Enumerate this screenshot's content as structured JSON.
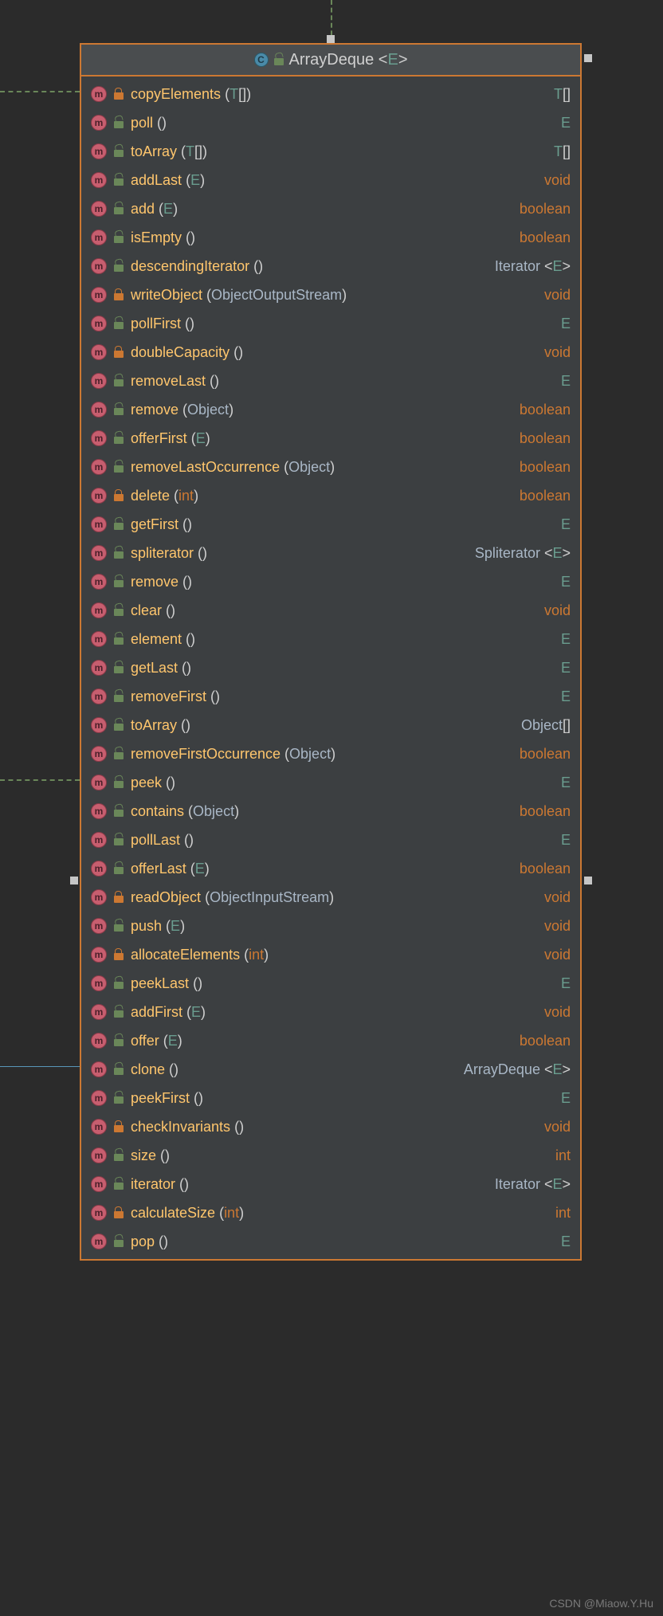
{
  "title": {
    "name": "ArrayDeque",
    "generic": "E"
  },
  "watermark": "CSDN @Miaow.Y.Hu",
  "methods": [
    {
      "name": "copyElements",
      "params": [
        {
          "t": "T",
          "sfx": "[]",
          "cls": "gen"
        }
      ],
      "ret": {
        "t": "T",
        "sfx": "[]",
        "cls": "gen"
      },
      "access": "private"
    },
    {
      "name": "poll",
      "params": [],
      "ret": {
        "t": "E",
        "cls": "gen"
      },
      "access": "public"
    },
    {
      "name": "toArray",
      "params": [
        {
          "t": "T",
          "sfx": "[]",
          "cls": "gen"
        }
      ],
      "ret": {
        "t": "T",
        "sfx": "[]",
        "cls": "gen"
      },
      "access": "public"
    },
    {
      "name": "addLast",
      "params": [
        {
          "t": "E",
          "cls": "gen"
        }
      ],
      "ret": {
        "t": "void",
        "cls": "void"
      },
      "access": "public"
    },
    {
      "name": "add",
      "params": [
        {
          "t": "E",
          "cls": "gen"
        }
      ],
      "ret": {
        "t": "boolean",
        "cls": "bool"
      },
      "access": "public"
    },
    {
      "name": "isEmpty",
      "params": [],
      "ret": {
        "t": "boolean",
        "cls": "bool"
      },
      "access": "public"
    },
    {
      "name": "descendingIterator",
      "params": [],
      "ret": {
        "t": "Iterator",
        "gen": "E",
        "cls": "obj"
      },
      "access": "public"
    },
    {
      "name": "writeObject",
      "params": [
        {
          "t": "ObjectOutputStream",
          "cls": "obj"
        }
      ],
      "ret": {
        "t": "void",
        "cls": "void"
      },
      "access": "private"
    },
    {
      "name": "pollFirst",
      "params": [],
      "ret": {
        "t": "E",
        "cls": "gen"
      },
      "access": "public"
    },
    {
      "name": "doubleCapacity",
      "params": [],
      "ret": {
        "t": "void",
        "cls": "void"
      },
      "access": "private"
    },
    {
      "name": "removeLast",
      "params": [],
      "ret": {
        "t": "E",
        "cls": "gen"
      },
      "access": "public"
    },
    {
      "name": "remove",
      "params": [
        {
          "t": "Object",
          "cls": "obj"
        }
      ],
      "ret": {
        "t": "boolean",
        "cls": "bool"
      },
      "access": "public"
    },
    {
      "name": "offerFirst",
      "params": [
        {
          "t": "E",
          "cls": "gen"
        }
      ],
      "ret": {
        "t": "boolean",
        "cls": "bool"
      },
      "access": "public"
    },
    {
      "name": "removeLastOccurrence",
      "params": [
        {
          "t": "Object",
          "cls": "obj"
        }
      ],
      "ret": {
        "t": "boolean",
        "cls": "bool"
      },
      "access": "public"
    },
    {
      "name": "delete",
      "params": [
        {
          "t": "int",
          "cls": "prim"
        }
      ],
      "ret": {
        "t": "boolean",
        "cls": "bool"
      },
      "access": "private"
    },
    {
      "name": "getFirst",
      "params": [],
      "ret": {
        "t": "E",
        "cls": "gen"
      },
      "access": "public"
    },
    {
      "name": "spliterator",
      "params": [],
      "ret": {
        "t": "Spliterator",
        "gen": "E",
        "cls": "obj"
      },
      "access": "public"
    },
    {
      "name": "remove",
      "params": [],
      "ret": {
        "t": "E",
        "cls": "gen"
      },
      "access": "public"
    },
    {
      "name": "clear",
      "params": [],
      "ret": {
        "t": "void",
        "cls": "void"
      },
      "access": "public"
    },
    {
      "name": "element",
      "params": [],
      "ret": {
        "t": "E",
        "cls": "gen"
      },
      "access": "public"
    },
    {
      "name": "getLast",
      "params": [],
      "ret": {
        "t": "E",
        "cls": "gen"
      },
      "access": "public"
    },
    {
      "name": "removeFirst",
      "params": [],
      "ret": {
        "t": "E",
        "cls": "gen"
      },
      "access": "public"
    },
    {
      "name": "toArray",
      "params": [],
      "ret": {
        "t": "Object",
        "sfx": "[]",
        "cls": "obj"
      },
      "access": "public"
    },
    {
      "name": "removeFirstOccurrence",
      "params": [
        {
          "t": "Object",
          "cls": "obj"
        }
      ],
      "ret": {
        "t": "boolean",
        "cls": "bool"
      },
      "access": "public"
    },
    {
      "name": "peek",
      "params": [],
      "ret": {
        "t": "E",
        "cls": "gen"
      },
      "access": "public"
    },
    {
      "name": "contains",
      "params": [
        {
          "t": "Object",
          "cls": "obj"
        }
      ],
      "ret": {
        "t": "boolean",
        "cls": "bool"
      },
      "access": "public"
    },
    {
      "name": "pollLast",
      "params": [],
      "ret": {
        "t": "E",
        "cls": "gen"
      },
      "access": "public"
    },
    {
      "name": "offerLast",
      "params": [
        {
          "t": "E",
          "cls": "gen"
        }
      ],
      "ret": {
        "t": "boolean",
        "cls": "bool"
      },
      "access": "public"
    },
    {
      "name": "readObject",
      "params": [
        {
          "t": "ObjectInputStream",
          "cls": "obj"
        }
      ],
      "ret": {
        "t": "void",
        "cls": "void"
      },
      "access": "private"
    },
    {
      "name": "push",
      "params": [
        {
          "t": "E",
          "cls": "gen"
        }
      ],
      "ret": {
        "t": "void",
        "cls": "void"
      },
      "access": "public"
    },
    {
      "name": "allocateElements",
      "params": [
        {
          "t": "int",
          "cls": "prim"
        }
      ],
      "ret": {
        "t": "void",
        "cls": "void"
      },
      "access": "private"
    },
    {
      "name": "peekLast",
      "params": [],
      "ret": {
        "t": "E",
        "cls": "gen"
      },
      "access": "public"
    },
    {
      "name": "addFirst",
      "params": [
        {
          "t": "E",
          "cls": "gen"
        }
      ],
      "ret": {
        "t": "void",
        "cls": "void"
      },
      "access": "public"
    },
    {
      "name": "offer",
      "params": [
        {
          "t": "E",
          "cls": "gen"
        }
      ],
      "ret": {
        "t": "boolean",
        "cls": "bool"
      },
      "access": "public"
    },
    {
      "name": "clone",
      "params": [],
      "ret": {
        "t": "ArrayDeque",
        "gen": "E",
        "cls": "obj"
      },
      "access": "public"
    },
    {
      "name": "peekFirst",
      "params": [],
      "ret": {
        "t": "E",
        "cls": "gen"
      },
      "access": "public"
    },
    {
      "name": "checkInvariants",
      "params": [],
      "ret": {
        "t": "void",
        "cls": "void"
      },
      "access": "private"
    },
    {
      "name": "size",
      "params": [],
      "ret": {
        "t": "int",
        "cls": "int"
      },
      "access": "public"
    },
    {
      "name": "iterator",
      "params": [],
      "ret": {
        "t": "Iterator",
        "gen": "E",
        "cls": "obj"
      },
      "access": "public"
    },
    {
      "name": "calculateSize",
      "params": [
        {
          "t": "int",
          "cls": "prim"
        }
      ],
      "ret": {
        "t": "int",
        "cls": "int"
      },
      "access": "private"
    },
    {
      "name": "pop",
      "params": [],
      "ret": {
        "t": "E",
        "cls": "gen"
      },
      "access": "public"
    }
  ]
}
